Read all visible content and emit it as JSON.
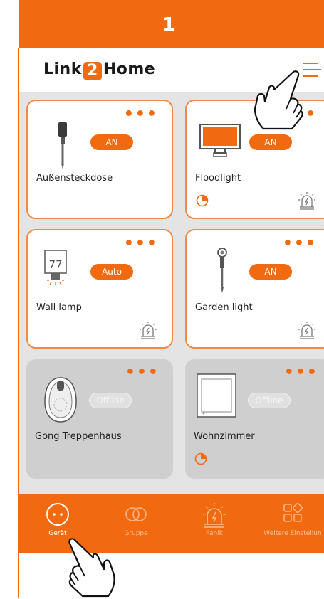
{
  "step_number": "1",
  "app": {
    "logo_left": "Link",
    "logo_num": "2",
    "logo_right": "Home"
  },
  "devices": [
    {
      "name": "Außensteckdose",
      "status": "AN",
      "online": true
    },
    {
      "name": "Floodlight",
      "status": "AN",
      "online": true
    },
    {
      "name": "Wall lamp",
      "status": "Auto",
      "online": true,
      "display_value": "77"
    },
    {
      "name": "Garden light",
      "status": "AN",
      "online": true
    },
    {
      "name": "Gong Treppenhaus",
      "status": "Offline",
      "online": false
    },
    {
      "name": "Wohnzimmer",
      "status": "Offline",
      "online": false
    }
  ],
  "more_label": "•••",
  "nav": [
    {
      "label": "Gerät",
      "active": true
    },
    {
      "label": "Gruppe",
      "active": false
    },
    {
      "label": "Panik",
      "active": false
    },
    {
      "label": "Weitere Einstellun",
      "active": false
    }
  ],
  "colors": {
    "accent": "#f26a10",
    "offline_card": "#cfcfcf",
    "grid_bg": "#e4e4e4"
  }
}
